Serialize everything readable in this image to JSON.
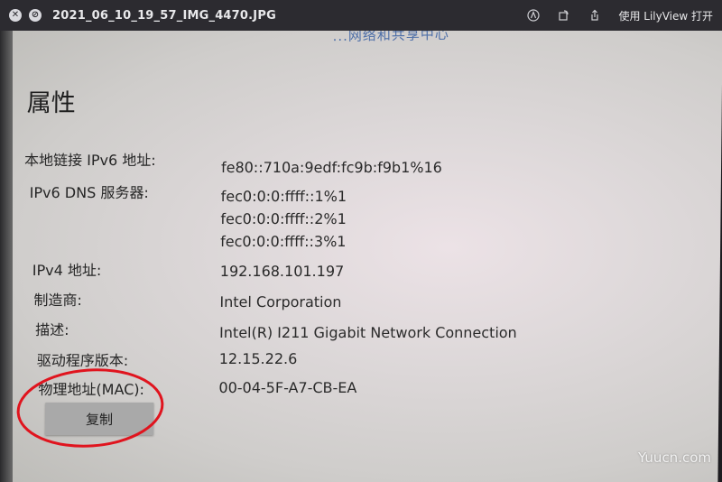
{
  "window": {
    "title": "2021_06_10_19_57_IMG_4470.JPG",
    "open_with": "使用 LilyView 打开",
    "icons": [
      "close-icon",
      "forbidden-icon",
      "markup-icon",
      "rotate-icon",
      "share-icon"
    ]
  },
  "photo": {
    "top_fragment": "...网络和共享中心",
    "heading": "属性",
    "rows": [
      {
        "label": "本地链接 IPv6 地址:",
        "value": "fe80::710a:9edf:fc9b:f9b1%16"
      },
      {
        "label": "IPv6 DNS 服务器:",
        "value": "fec0:0:0:ffff::1%1"
      },
      {
        "label": "",
        "value": "fec0:0:0:ffff::2%1"
      },
      {
        "label": "",
        "value": "fec0:0:0:ffff::3%1"
      },
      {
        "label": "IPv4 地址:",
        "value": "192.168.101.197"
      },
      {
        "label": "制造商:",
        "value": "Intel Corporation"
      },
      {
        "label": "描述:",
        "value": "Intel(R) I211 Gigabit Network Connection"
      },
      {
        "label": "驱动程序版本:",
        "value": "12.15.22.6"
      },
      {
        "label": "物理地址(MAC):",
        "value": "00-04-5F-A7-CB-EA"
      }
    ],
    "copy_button": "复制",
    "annotation_color": "#e0141e"
  },
  "watermark": "Yuucn.com"
}
